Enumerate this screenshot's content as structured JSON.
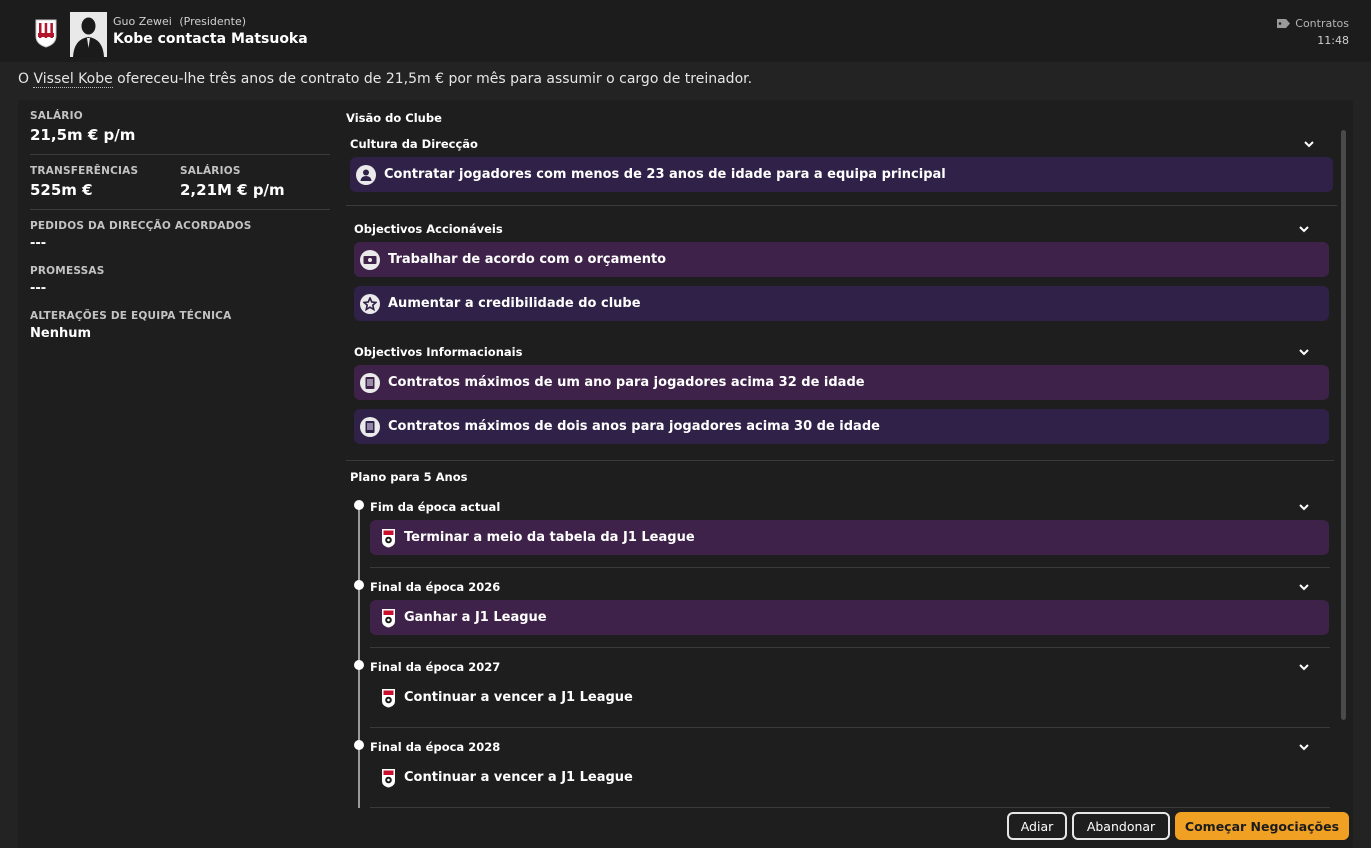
{
  "header": {
    "sender_name": "Guo Zewei",
    "sender_role": "(Presidente)",
    "title": "Kobe contacta Matsuoka",
    "category": "Contratos",
    "time": "11:48"
  },
  "intro": {
    "prefix": "O ",
    "club": "Vissel Kobe",
    "text": " ofereceu-lhe três anos de contrato de 21,5m € por mês para assumir o cargo de treinador."
  },
  "left": {
    "salary_label": "SALÁRIO",
    "salary_value": "21,5m € p/m",
    "transfers_label": "TRANSFERÊNCIAS",
    "transfers_value": "525m €",
    "wages_label": "SALÁRIOS",
    "wages_value": "2,21M € p/m",
    "board_requests_label": "PEDIDOS DA DIRECÇÃO ACORDADOS",
    "board_requests_value": "---",
    "promises_label": "PROMESSAS",
    "promises_value": "---",
    "staff_changes_label": "ALTERAÇÕES DE EQUIPA TÉCNICA",
    "staff_changes_value": "Nenhum"
  },
  "vision": {
    "title": "Visão do Clube",
    "culture": {
      "heading": "Cultura da Direcção",
      "items": [
        "Contratar jogadores com menos de 23 anos de idade para a equipa principal"
      ]
    },
    "actionable": {
      "heading": "Objectivos Accionáveis",
      "items": [
        "Trabalhar de acordo com o orçamento",
        "Aumentar a credibilidade do clube"
      ]
    },
    "informational": {
      "heading": "Objectivos Informacionais",
      "items": [
        "Contratos máximos de um ano para jogadores acima 32 de idade",
        "Contratos máximos de dois anos para jogadores acima 30 de idade"
      ]
    },
    "plan": {
      "heading": "Plano para 5 Anos",
      "stages": [
        {
          "label": "Fim da época actual",
          "goal": "Terminar a meio da tabela da J1 League"
        },
        {
          "label": "Final da época 2026",
          "goal": "Ganhar a J1 League"
        },
        {
          "label": "Final da época 2027",
          "goal": "Continuar a vencer a J1 League"
        },
        {
          "label": "Final da época 2028",
          "goal": "Continuar a vencer a J1 League"
        }
      ]
    }
  },
  "buttons": {
    "postpone": "Adiar",
    "abandon": "Abandonar",
    "start": "Começar Negociações"
  },
  "colors": {
    "accent": "#f0a023",
    "goal_dark": "#2f2147",
    "goal_purple": "#3f2249"
  },
  "icons": [
    "club-badge-icon",
    "person-icon",
    "money-icon",
    "star-icon",
    "contract-icon",
    "j1-league-icon",
    "chevron-down-icon",
    "tag-icon"
  ]
}
